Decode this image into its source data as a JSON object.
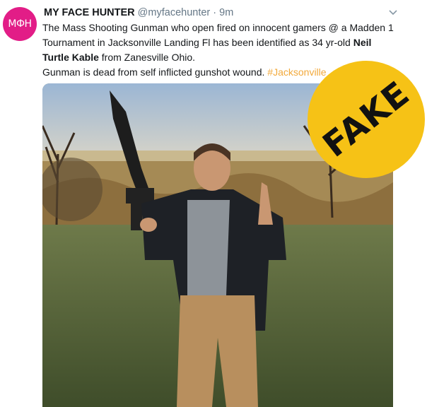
{
  "author": {
    "avatar_text": "MФH",
    "name": "MY FACE HUNTER",
    "handle": "@myfacehunter",
    "dot": "·",
    "time": "9m"
  },
  "tweet": {
    "line1": "The Mass Shooting Gunman who open fired on innocent gamers @ a Madden 1",
    "line2_a": "Tournament in Jacksonville Landing Fl has been identified as 34 yr-old ",
    "line2_bold": "Neil",
    "line3_bold": "Turtle Kable",
    "line3_b": " from Zanesville Ohio.",
    "line4_a": "Gunman is dead from self inflicted gunshot wound. ",
    "hashtag": "#Jacksonville"
  },
  "badge": {
    "label": "FAKE",
    "color": "#f6c216"
  },
  "icons": {
    "menu": "chevron-down-icon"
  }
}
